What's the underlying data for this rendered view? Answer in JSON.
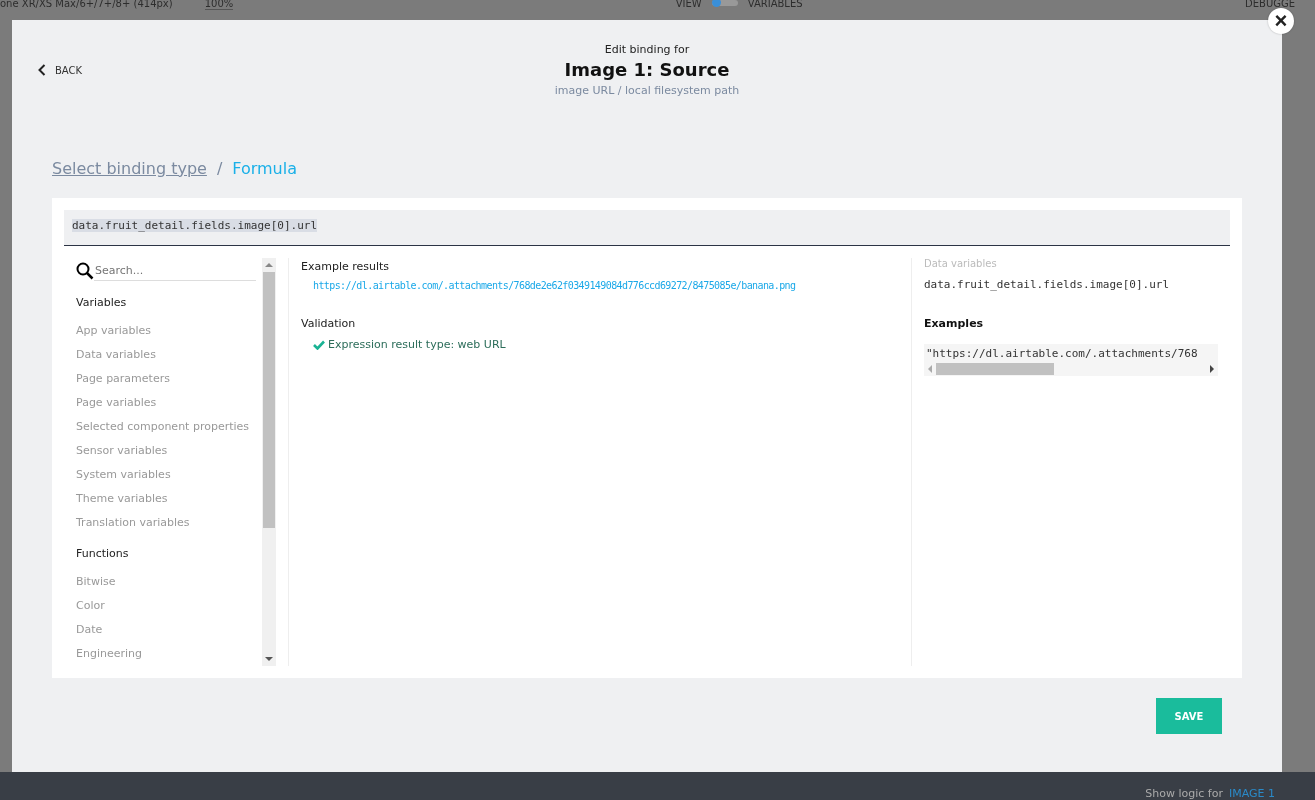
{
  "background": {
    "device": "one XR/XS Max/6+/7+/8+ (414px)",
    "zoom": "100%",
    "view_label": "VIEW",
    "variables_label": "VARIABLES",
    "debugger_label": "DEBUGGE",
    "toggle_on": false,
    "footer_label": "Show logic for",
    "footer_target": "IMAGE 1"
  },
  "dialog": {
    "back": "BACK",
    "subtitle_top": "Edit binding for",
    "title": "Image 1: Source",
    "subtitle": "image URL / local filesystem path",
    "close": "×",
    "breadcrumb_separator": "/",
    "breadcrumb": [
      {
        "label": "Select binding type",
        "selected": false
      },
      {
        "label": "Formula",
        "selected": true
      }
    ],
    "formula": "data.fruit_detail.fields.image[0].url",
    "search": {
      "placeholder": "Search..."
    },
    "library": [
      {
        "kind": "header",
        "label": "Variables"
      },
      {
        "kind": "item",
        "label": "App variables"
      },
      {
        "kind": "item",
        "label": "Data variables"
      },
      {
        "kind": "item",
        "label": "Page parameters"
      },
      {
        "kind": "item",
        "label": "Page variables"
      },
      {
        "kind": "item",
        "label": "Selected component properties"
      },
      {
        "kind": "item",
        "label": "Sensor variables"
      },
      {
        "kind": "item",
        "label": "System variables"
      },
      {
        "kind": "item",
        "label": "Theme variables"
      },
      {
        "kind": "item",
        "label": "Translation variables"
      },
      {
        "kind": "header",
        "label": "Functions"
      },
      {
        "kind": "item",
        "label": "Bitwise"
      },
      {
        "kind": "item",
        "label": "Color"
      },
      {
        "kind": "item",
        "label": "Date"
      },
      {
        "kind": "item",
        "label": "Engineering"
      }
    ],
    "results_label": "Example results",
    "result": "https://dl.airtable.com/.attachments/768de2e62f0349149084d776ccd69272/8475085e/banana.png",
    "validation_label": "Validation",
    "validation": {
      "valid": true,
      "text": "Expression result type: web URL"
    },
    "info": {
      "category": "Data variables",
      "name": "data.fruit_detail.fields.image[0].url",
      "examples_label": "Examples",
      "example": "\"https://dl.airtable.com/.attachments/768"
    },
    "save": "SAVE"
  }
}
